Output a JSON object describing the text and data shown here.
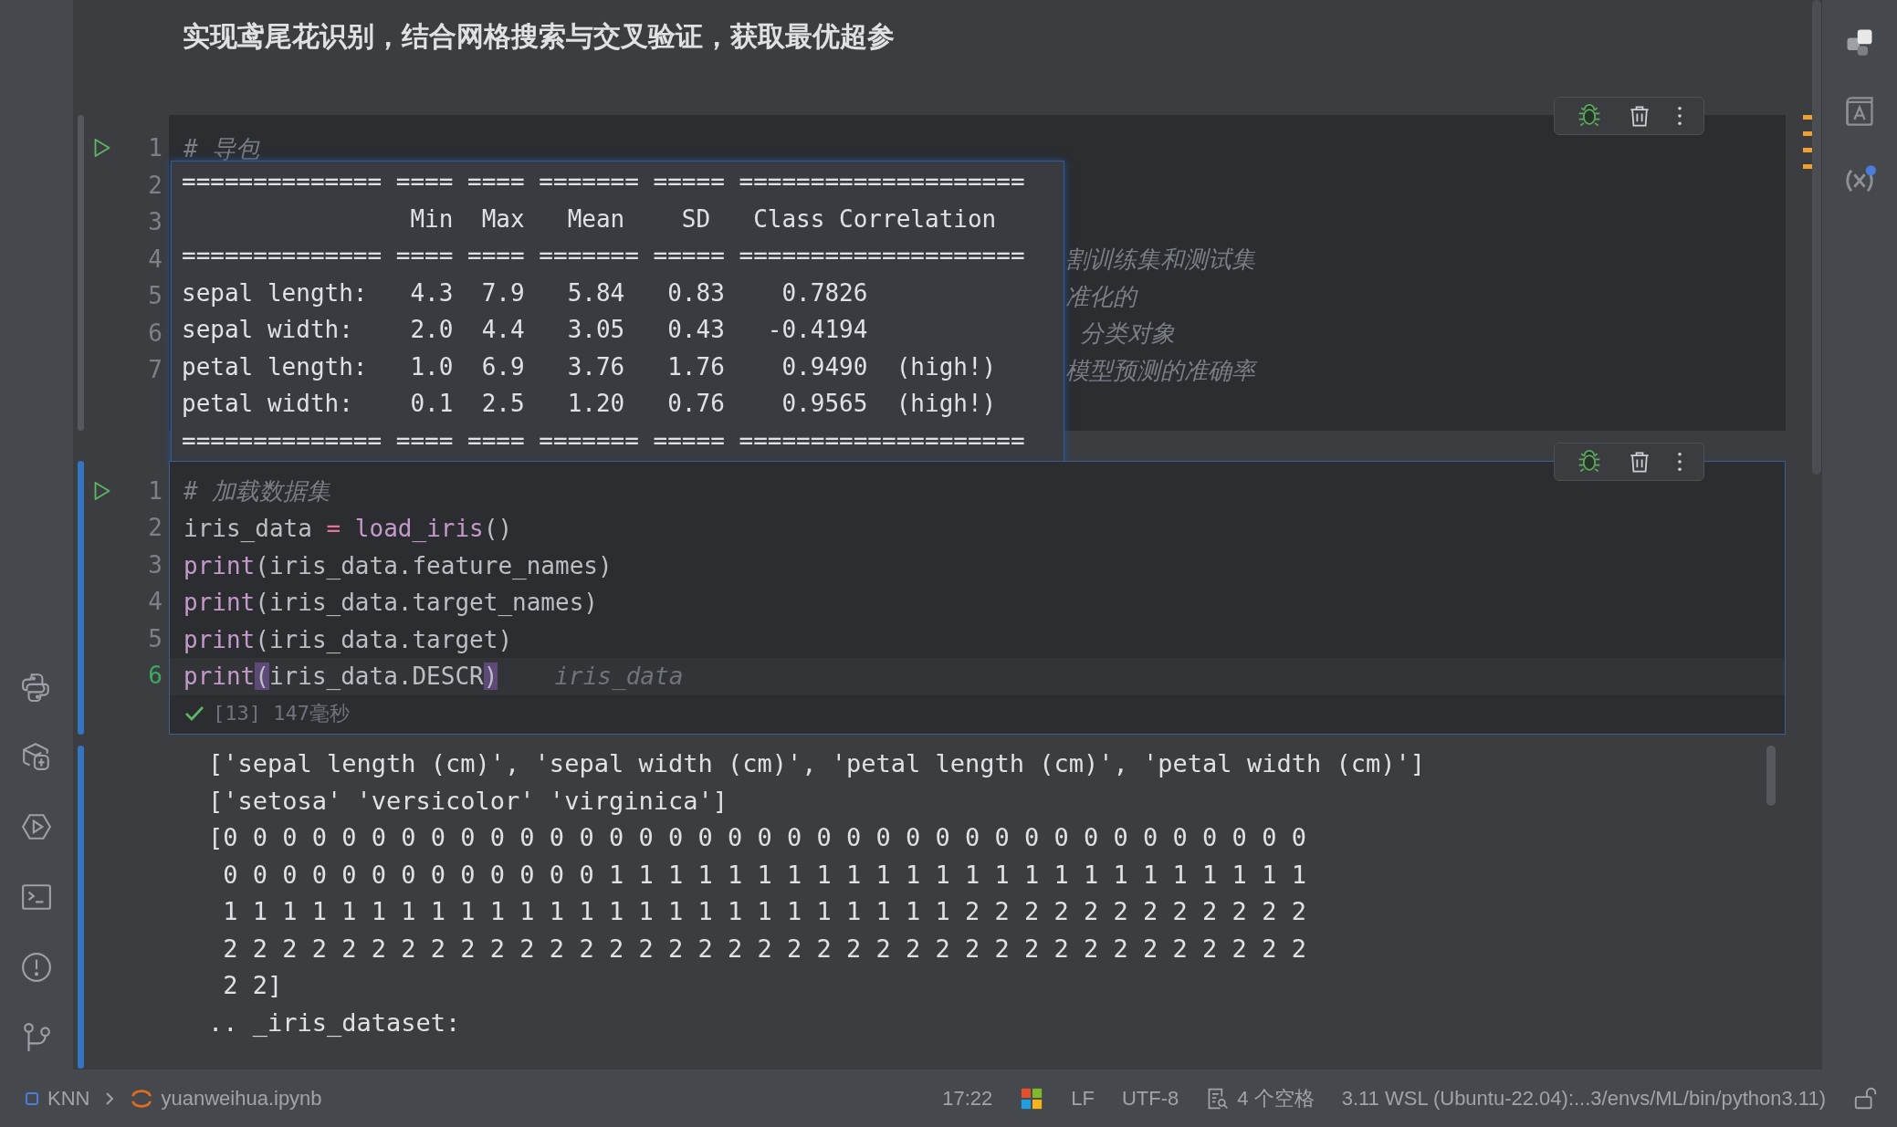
{
  "markdown_heading": "实现鸢尾花识别，结合网格搜索与交叉验证，获取最优超参",
  "cells": [
    {
      "selected": false,
      "lines": [
        {
          "number": "1",
          "current": false,
          "tokens": [
            {
              "kind": "comment",
              "text": "# 导包"
            }
          ]
        },
        {
          "number": "2",
          "current": false
        },
        {
          "number": "3",
          "current": false
        },
        {
          "number": "4",
          "current": false,
          "tokens": [
            {
              "kind": "comment",
              "text": "割训练集和测试集"
            }
          ]
        },
        {
          "number": "5",
          "current": false,
          "tokens": [
            {
              "kind": "comment",
              "text": "准化的"
            }
          ]
        },
        {
          "number": "6",
          "current": false,
          "tokens": [
            {
              "kind": "comment",
              "text": " 分类对象"
            }
          ]
        },
        {
          "number": "7",
          "current": false,
          "tokens": [
            {
              "kind": "comment",
              "text": "模型预测的准确率"
            }
          ]
        }
      ],
      "quick_doc": {
        "lines": [
          "============== ==== ==== ======= ===== ====================",
          "                Min  Max   Mean    SD   Class Correlation",
          "============== ==== ==== ======= ===== ====================",
          "sepal length:   4.3  7.9   5.84   0.83    0.7826",
          "sepal width:    2.0  4.4   3.05   0.43   -0.4194",
          "petal length:   1.0  6.9   3.76   1.76    0.9490  (high!)",
          "petal width:    0.1  2.5   1.20   0.76    0.9565  (high!)",
          "============== ==== ==== ======= ===== ===================="
        ]
      }
    },
    {
      "selected": true,
      "lines": [
        {
          "number": "1",
          "current": false,
          "tokens": [
            {
              "kind": "comment",
              "text": "# 加载数据集"
            }
          ]
        },
        {
          "number": "2",
          "current": false,
          "tokens": [
            {
              "kind": "plain",
              "text": "iris_data "
            },
            {
              "kind": "op",
              "text": "= "
            },
            {
              "kind": "func",
              "text": "load_iris"
            },
            {
              "kind": "plain",
              "text": "()"
            }
          ]
        },
        {
          "number": "3",
          "current": false,
          "tokens": [
            {
              "kind": "func",
              "text": "print"
            },
            {
              "kind": "plain",
              "text": "(iris_data.feature_names)"
            }
          ]
        },
        {
          "number": "4",
          "current": false,
          "tokens": [
            {
              "kind": "func",
              "text": "print"
            },
            {
              "kind": "plain",
              "text": "(iris_data.target_names)"
            }
          ]
        },
        {
          "number": "5",
          "current": false,
          "tokens": [
            {
              "kind": "func",
              "text": "print"
            },
            {
              "kind": "plain",
              "text": "(iris_data.target)"
            }
          ]
        },
        {
          "number": "6",
          "current": true,
          "tokens": [
            {
              "kind": "func",
              "text": "print"
            },
            {
              "kind": "bracket",
              "text": "("
            },
            {
              "kind": "plain",
              "text": "iris_data.DESCR"
            },
            {
              "kind": "bracket",
              "text": ")"
            }
          ],
          "hint": "iris_data"
        }
      ],
      "execution": {
        "ok": true,
        "text": "[13] 147毫秒"
      },
      "output": {
        "lines": [
          "['sepal length (cm)', 'sepal width (cm)', 'petal length (cm)', 'petal width (cm)']",
          "['setosa' 'versicolor' 'virginica']",
          "[0 0 0 0 0 0 0 0 0 0 0 0 0 0 0 0 0 0 0 0 0 0 0 0 0 0 0 0 0 0 0 0 0 0 0 0 0",
          " 0 0 0 0 0 0 0 0 0 0 0 0 0 1 1 1 1 1 1 1 1 1 1 1 1 1 1 1 1 1 1 1 1 1 1 1 1",
          " 1 1 1 1 1 1 1 1 1 1 1 1 1 1 1 1 1 1 1 1 1 1 1 1 1 2 2 2 2 2 2 2 2 2 2 2 2",
          " 2 2 2 2 2 2 2 2 2 2 2 2 2 2 2 2 2 2 2 2 2 2 2 2 2 2 2 2 2 2 2 2 2 2 2 2 2",
          " 2 2]",
          ".. _iris_dataset:"
        ]
      }
    }
  ],
  "status_bar": {
    "project": "KNN",
    "file": "yuanweihua.ipynb",
    "position": "17:22",
    "line_separator": "LF",
    "encoding": "UTF-8",
    "indent": "4 个空格",
    "interpreter": "3.11 WSL (Ubuntu-22.04):...3/envs/ML/bin/python3.11)"
  }
}
